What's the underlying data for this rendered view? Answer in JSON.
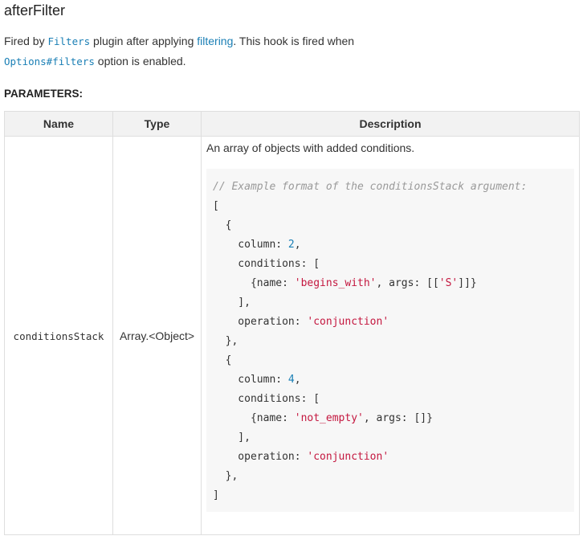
{
  "hook": {
    "title": "afterFilter"
  },
  "description": {
    "fired_by": "Fired by ",
    "plugin_code": "Filters",
    "plugin_after": " plugin after applying ",
    "filtering_link": "filtering",
    "after_link": ". This hook is fired when",
    "option_code": "Options#filters",
    "option_after": " option is enabled."
  },
  "parameters": {
    "heading": "PARAMETERS:",
    "columns": [
      "Name",
      "Type",
      "Description"
    ],
    "rows": [
      {
        "name": "conditionsStack",
        "type": "Array.<Object>",
        "description": "An array of objects with added conditions."
      }
    ]
  },
  "code": {
    "comment": "// Example format of the conditionsStack argument:",
    "col1": "2",
    "col2": "4",
    "begins_with": "'begins_with'",
    "args_s": "'S'",
    "not_empty": "'not_empty'",
    "conjunction": "'conjunction'"
  },
  "colors": {
    "link": "#1a7fb5",
    "string": "#c4173f",
    "number": "#1a7fb5",
    "comment": "#999999",
    "header_bg": "#f2f2f2",
    "code_bg": "#f7f7f7"
  }
}
